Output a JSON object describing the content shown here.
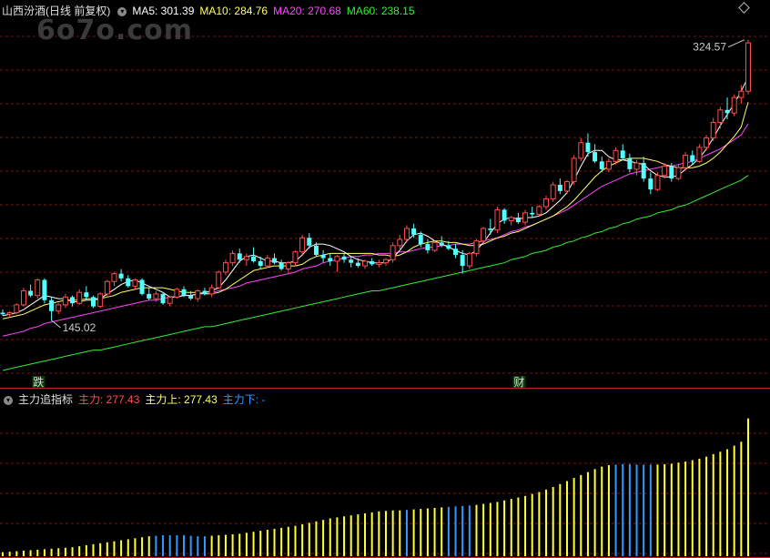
{
  "header": {
    "title": "山西汾酒(日线 前复权)",
    "ma5_label": "MA5: 301.39",
    "ma10_label": "MA10: 284.76",
    "ma20_label": "MA20: 270.68",
    "ma60_label": "MA60: 238.15"
  },
  "watermark": "6o7o.com",
  "sub_header": {
    "title": "主力追指标",
    "main_label": "主力: 277.43",
    "up_label": "主力上: 277.43",
    "down_label": "主力下: -"
  },
  "colors": {
    "up": "#ff4d4d",
    "down": "#54ffff",
    "ma5": "#ffffff",
    "ma10": "#ffff66",
    "ma20": "#ff44ff",
    "ma60": "#33ee33",
    "bar_up": "#ffff33",
    "bar_down": "#3399ff"
  },
  "chart_data": [
    {
      "type": "candlestick",
      "title": "山西汾酒(日线 前复权)",
      "ylim": [
        110,
        340
      ],
      "annotations": [
        {
          "label": "145.02",
          "type": "low",
          "index": 7
        },
        {
          "label": "324.57",
          "type": "high",
          "index": 107
        }
      ],
      "markers": [
        {
          "label": "跌",
          "index": 5
        },
        {
          "label": "财",
          "index": 74
        }
      ],
      "candles": [
        [
          150,
          152,
          148,
          149
        ],
        [
          149,
          151,
          147,
          150
        ],
        [
          150,
          156,
          149,
          155
        ],
        [
          155,
          166,
          154,
          164
        ],
        [
          164,
          168,
          160,
          161
        ],
        [
          161,
          172,
          159,
          171
        ],
        [
          171,
          172,
          156,
          158
        ],
        [
          158,
          160,
          145,
          151
        ],
        [
          151,
          156,
          149,
          155
        ],
        [
          155,
          162,
          153,
          160
        ],
        [
          160,
          161,
          154,
          156
        ],
        [
          156,
          165,
          155,
          163
        ],
        [
          163,
          167,
          158,
          160
        ],
        [
          160,
          161,
          153,
          154
        ],
        [
          154,
          163,
          153,
          162
        ],
        [
          162,
          171,
          160,
          170
        ],
        [
          170,
          176,
          167,
          175
        ],
        [
          175,
          178,
          170,
          172
        ],
        [
          172,
          174,
          166,
          167
        ],
        [
          167,
          172,
          165,
          171
        ],
        [
          171,
          172,
          161,
          162
        ],
        [
          162,
          166,
          158,
          159
        ],
        [
          159,
          164,
          157,
          162
        ],
        [
          162,
          163,
          155,
          156
        ],
        [
          156,
          161,
          154,
          160
        ],
        [
          160,
          166,
          159,
          165
        ],
        [
          165,
          167,
          160,
          161
        ],
        [
          161,
          164,
          158,
          159
        ],
        [
          159,
          165,
          157,
          164
        ],
        [
          164,
          166,
          161,
          162
        ],
        [
          162,
          168,
          160,
          166
        ],
        [
          166,
          177,
          165,
          176
        ],
        [
          176,
          184,
          174,
          182
        ],
        [
          182,
          190,
          180,
          188
        ],
        [
          188,
          191,
          182,
          184
        ],
        [
          184,
          188,
          180,
          186
        ],
        [
          186,
          192,
          182,
          183
        ],
        [
          183,
          186,
          178,
          180
        ],
        [
          180,
          187,
          179,
          185
        ],
        [
          185,
          188,
          181,
          182
        ],
        [
          182,
          184,
          177,
          178
        ],
        [
          178,
          183,
          175,
          182
        ],
        [
          182,
          190,
          180,
          189
        ],
        [
          189,
          200,
          187,
          198
        ],
        [
          198,
          201,
          191,
          193
        ],
        [
          193,
          195,
          186,
          187
        ],
        [
          187,
          190,
          182,
          185
        ],
        [
          185,
          188,
          180,
          183
        ],
        [
          183,
          187,
          176,
          186
        ],
        [
          186,
          188,
          182,
          184
        ],
        [
          184,
          186,
          179,
          182
        ],
        [
          182,
          185,
          179,
          180
        ],
        [
          180,
          184,
          178,
          183
        ],
        [
          183,
          185,
          180,
          181
        ],
        [
          181,
          184,
          179,
          182
        ],
        [
          182,
          185,
          180,
          184
        ],
        [
          184,
          195,
          182,
          193
        ],
        [
          193,
          200,
          190,
          197
        ],
        [
          197,
          206,
          195,
          204
        ],
        [
          204,
          207,
          198,
          200
        ],
        [
          200,
          202,
          192,
          194
        ],
        [
          194,
          197,
          188,
          190
        ],
        [
          190,
          196,
          189,
          195
        ],
        [
          195,
          199,
          192,
          193
        ],
        [
          193,
          196,
          190,
          191
        ],
        [
          191,
          194,
          185,
          187
        ],
        [
          187,
          190,
          175,
          180
        ],
        [
          180,
          189,
          178,
          188
        ],
        [
          188,
          197,
          186,
          196
        ],
        [
          196,
          205,
          194,
          204
        ],
        [
          204,
          210,
          200,
          203
        ],
        [
          203,
          218,
          201,
          216
        ],
        [
          216,
          217,
          207,
          209
        ],
        [
          209,
          212,
          206,
          211
        ],
        [
          211,
          214,
          207,
          208
        ],
        [
          208,
          216,
          206,
          214
        ],
        [
          214,
          218,
          211,
          213
        ],
        [
          213,
          219,
          212,
          218
        ],
        [
          218,
          225,
          216,
          223
        ],
        [
          223,
          234,
          221,
          232
        ],
        [
          232,
          236,
          226,
          228
        ],
        [
          228,
          235,
          226,
          234
        ],
        [
          234,
          251,
          232,
          249
        ],
        [
          249,
          262,
          247,
          259
        ],
        [
          259,
          265,
          250,
          253
        ],
        [
          253,
          258,
          246,
          247
        ],
        [
          247,
          250,
          240,
          242
        ],
        [
          242,
          249,
          240,
          247
        ],
        [
          247,
          256,
          245,
          254
        ],
        [
          254,
          258,
          248,
          249
        ],
        [
          249,
          252,
          240,
          242
        ],
        [
          242,
          248,
          238,
          246
        ],
        [
          246,
          250,
          234,
          236
        ],
        [
          236,
          240,
          226,
          229
        ],
        [
          229,
          240,
          228,
          238
        ],
        [
          238,
          246,
          236,
          244
        ],
        [
          244,
          246,
          234,
          236
        ],
        [
          236,
          245,
          235,
          243
        ],
        [
          243,
          253,
          241,
          251
        ],
        [
          251,
          254,
          245,
          247
        ],
        [
          247,
          258,
          246,
          256
        ],
        [
          256,
          264,
          254,
          262
        ],
        [
          262,
          275,
          260,
          272
        ],
        [
          272,
          282,
          268,
          280
        ],
        [
          280,
          288,
          274,
          278
        ],
        [
          278,
          290,
          276,
          288
        ],
        [
          288,
          296,
          284,
          292
        ],
        [
          292,
          325,
          290,
          323
        ]
      ],
      "ma5": [
        148,
        149,
        150,
        152,
        155,
        158,
        161,
        160,
        159,
        159,
        157,
        157,
        158,
        158,
        159,
        162,
        165,
        168,
        170,
        171,
        169,
        167,
        165,
        163,
        160,
        160,
        161,
        161,
        162,
        163,
        164,
        166,
        171,
        177,
        183,
        186,
        187,
        185,
        183,
        183,
        182,
        182,
        183,
        187,
        192,
        194,
        194,
        193,
        191,
        189,
        186,
        184,
        183,
        182,
        182,
        182,
        185,
        190,
        196,
        200,
        201,
        199,
        196,
        194,
        192,
        190,
        188,
        187,
        190,
        195,
        201,
        207,
        210,
        211,
        210,
        211,
        211,
        212,
        214,
        218,
        222,
        227,
        235,
        244,
        252,
        254,
        254,
        250,
        248,
        248,
        247,
        246,
        245,
        241,
        238,
        237,
        237,
        238,
        242,
        245,
        249,
        255,
        262,
        270,
        277,
        284,
        292,
        301
      ],
      "ma10": [
        146,
        147,
        148,
        149,
        151,
        153,
        155,
        156,
        157,
        158,
        158,
        158,
        159,
        159,
        159,
        160,
        161,
        163,
        164,
        165,
        166,
        166,
        166,
        166,
        165,
        164,
        163,
        163,
        163,
        162,
        162,
        163,
        165,
        168,
        171,
        174,
        177,
        178,
        179,
        180,
        180,
        180,
        180,
        181,
        184,
        186,
        187,
        188,
        188,
        188,
        188,
        188,
        188,
        188,
        187,
        187,
        186,
        187,
        189,
        192,
        194,
        195,
        196,
        196,
        195,
        195,
        194,
        193,
        193,
        194,
        196,
        198,
        199,
        201,
        202,
        204,
        206,
        208,
        210,
        212,
        215,
        218,
        222,
        227,
        232,
        237,
        241,
        244,
        246,
        248,
        249,
        249,
        249,
        248,
        247,
        245,
        244,
        243,
        243,
        243,
        244,
        246,
        249,
        253,
        258,
        263,
        269,
        285
      ],
      "ma20": [
        135,
        136,
        137,
        138,
        140,
        141,
        143,
        144,
        145,
        146,
        147,
        148,
        149,
        150,
        151,
        152,
        153,
        154,
        155,
        156,
        157,
        158,
        158,
        159,
        160,
        160,
        161,
        161,
        162,
        162,
        163,
        164,
        165,
        166,
        167,
        169,
        170,
        171,
        172,
        173,
        174,
        175,
        176,
        178,
        179,
        180,
        182,
        183,
        184,
        185,
        186,
        186,
        187,
        187,
        188,
        188,
        188,
        189,
        189,
        190,
        191,
        192,
        192,
        193,
        193,
        194,
        194,
        194,
        195,
        196,
        197,
        198,
        200,
        202,
        203,
        205,
        206,
        208,
        210,
        212,
        214,
        216,
        219,
        222,
        225,
        228,
        231,
        233,
        235,
        237,
        239,
        240,
        241,
        242,
        243,
        244,
        244,
        245,
        246,
        247,
        249,
        251,
        253,
        255,
        258,
        261,
        264,
        271
      ],
      "ma60": [
        113,
        114,
        115,
        116,
        117,
        118,
        119,
        120,
        121,
        122,
        123,
        124,
        125,
        126,
        126,
        127,
        128,
        129,
        130,
        131,
        132,
        133,
        134,
        135,
        136,
        137,
        138,
        139,
        140,
        141,
        141,
        142,
        143,
        144,
        145,
        146,
        147,
        148,
        149,
        150,
        151,
        152,
        153,
        154,
        155,
        156,
        157,
        158,
        159,
        160,
        161,
        162,
        163,
        164,
        164,
        165,
        166,
        167,
        168,
        169,
        170,
        171,
        172,
        173,
        174,
        175,
        176,
        177,
        178,
        179,
        180,
        181,
        182,
        184,
        185,
        186,
        188,
        189,
        190,
        192,
        193,
        195,
        196,
        198,
        199,
        201,
        202,
        204,
        205,
        207,
        208,
        210,
        211,
        212,
        214,
        215,
        216,
        218,
        219,
        221,
        223,
        225,
        227,
        229,
        231,
        233,
        235,
        238
      ]
    },
    {
      "type": "bar",
      "title": "主力追指标",
      "ylim": [
        0,
        300
      ],
      "series": [
        {
          "name": "主力上",
          "values": [
            8,
            9,
            10,
            11,
            12,
            13,
            14,
            15,
            16,
            17,
            18,
            20,
            22,
            24,
            26,
            28,
            30,
            32,
            34,
            36,
            38,
            40,
            41,
            42,
            42,
            42,
            42,
            41,
            40,
            40,
            41,
            42,
            43,
            44,
            45,
            47,
            49,
            51,
            53,
            55,
            57,
            59,
            61,
            64,
            67,
            70,
            73,
            76,
            78,
            80,
            82,
            84,
            86,
            88,
            90,
            91,
            92,
            92,
            93,
            94,
            95,
            96,
            97,
            98,
            99,
            100,
            101,
            102,
            103,
            105,
            107,
            109,
            112,
            115,
            118,
            121,
            125,
            129,
            134,
            139,
            145,
            151,
            157,
            163,
            169,
            175,
            180,
            183,
            184,
            185,
            185,
            184,
            184,
            184,
            184,
            185,
            186,
            188,
            190,
            193,
            196,
            200,
            205,
            210,
            215,
            222,
            230,
            277
          ]
        },
        {
          "name": "主力下",
          "values": [
            0,
            0,
            0,
            0,
            0,
            0,
            0,
            0,
            0,
            0,
            0,
            0,
            0,
            0,
            0,
            0,
            0,
            0,
            0,
            0,
            0,
            0,
            1,
            1,
            1,
            1,
            1,
            1,
            1,
            1,
            0,
            0,
            0,
            0,
            0,
            0,
            0,
            0,
            0,
            0,
            0,
            0,
            0,
            0,
            0,
            0,
            0,
            0,
            0,
            0,
            0,
            0,
            0,
            0,
            0,
            0,
            0,
            0,
            1,
            0,
            0,
            0,
            0,
            0,
            1,
            1,
            1,
            1,
            0,
            0,
            0,
            0,
            0,
            0,
            0,
            0,
            0,
            0,
            0,
            0,
            0,
            0,
            0,
            0,
            0,
            0,
            0,
            0,
            1,
            1,
            1,
            1,
            1,
            1,
            0,
            0,
            0,
            0,
            0,
            0,
            0,
            0,
            0,
            0,
            0,
            0,
            0,
            0
          ]
        }
      ]
    }
  ]
}
